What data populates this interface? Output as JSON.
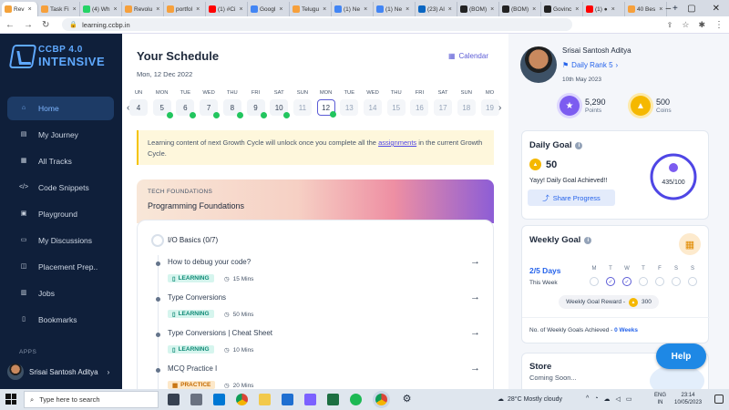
{
  "browser": {
    "tabs": [
      {
        "label": "Rev",
        "color": "#f4a23a",
        "active": true
      },
      {
        "label": "Task Fi",
        "color": "#f6a03c"
      },
      {
        "label": "(4) Wh",
        "color": "#25d366"
      },
      {
        "label": "Revolu",
        "color": "#f6a03c"
      },
      {
        "label": "portfol",
        "color": "#f6a03c"
      },
      {
        "label": "(1) #Ci",
        "color": "#ff0000"
      },
      {
        "label": "Googl",
        "color": "#4285f4"
      },
      {
        "label": "Telugu",
        "color": "#f6a03c"
      },
      {
        "label": "(1) Ne",
        "color": "#4285f4"
      },
      {
        "label": "(1) Ne",
        "color": "#4285f4"
      },
      {
        "label": "(23) Al",
        "color": "#0a66c2"
      },
      {
        "label": "(BOM)",
        "color": "#222222"
      },
      {
        "label": "(BOM)",
        "color": "#222222"
      },
      {
        "label": "Govinc",
        "color": "#222222"
      },
      {
        "label": "(1) ●",
        "color": "#ff0000"
      },
      {
        "label": "40 Bes",
        "color": "#f6a03c"
      }
    ],
    "url": "learning.ccbp.in"
  },
  "sidebar": {
    "logo_line1": "CCBP 4.0",
    "logo_line2": "INTENSIVE",
    "items": [
      {
        "label": "Home",
        "icon": "home-icon",
        "active": true
      },
      {
        "label": "My Journey",
        "icon": "journey-icon"
      },
      {
        "label": "All Tracks",
        "icon": "tracks-icon"
      },
      {
        "label": "Code Snippets",
        "icon": "code-icon"
      },
      {
        "label": "Playground",
        "icon": "terminal-icon"
      },
      {
        "label": "My Discussions",
        "icon": "chat-icon"
      },
      {
        "label": "Placement Prep..",
        "icon": "briefcase-icon"
      },
      {
        "label": "Jobs",
        "icon": "jobs-icon"
      },
      {
        "label": "Bookmarks",
        "icon": "bookmark-icon"
      }
    ],
    "apps_label": "APPS",
    "user_name": "Srisai Santosh Aditya"
  },
  "schedule": {
    "title": "Your Schedule",
    "date": "Mon, 12 Dec 2022",
    "calendar_label": "Calendar",
    "days": [
      {
        "name": "UN",
        "num": "4",
        "done": false
      },
      {
        "name": "MON",
        "num": "5",
        "done": true
      },
      {
        "name": "TUE",
        "num": "6",
        "done": true
      },
      {
        "name": "WED",
        "num": "7",
        "done": true
      },
      {
        "name": "THU",
        "num": "8",
        "done": true
      },
      {
        "name": "FRI",
        "num": "9",
        "done": true
      },
      {
        "name": "SAT",
        "num": "10",
        "done": true
      },
      {
        "name": "SUN",
        "num": "11",
        "done": false
      },
      {
        "name": "MON",
        "num": "12",
        "done": true,
        "selected": true
      },
      {
        "name": "TUE",
        "num": "13",
        "done": false
      },
      {
        "name": "WED",
        "num": "14",
        "done": false
      },
      {
        "name": "THU",
        "num": "15",
        "done": false
      },
      {
        "name": "FRI",
        "num": "16",
        "done": false
      },
      {
        "name": "SAT",
        "num": "17",
        "done": false
      },
      {
        "name": "SUN",
        "num": "18",
        "done": false
      },
      {
        "name": "MO",
        "num": "19",
        "done": false
      }
    ],
    "notice_text": "Learning content of next Growth Cycle will unlock once you complete all the",
    "notice_link": "assignments",
    "notice_tail": "in the current Growth Cycle."
  },
  "course": {
    "category": "TECH FOUNDATIONS",
    "name": "Programming Foundations",
    "topic": "I/O Basics (0/7)",
    "lessons": [
      {
        "title": "How to debug your code?",
        "tag": "LEARNING",
        "time": "15 Mins"
      },
      {
        "title": "Type Conversions",
        "tag": "LEARNING",
        "time": "50 Mins"
      },
      {
        "title": "Type Conversions | Cheat Sheet",
        "tag": "LEARNING",
        "time": "10 Mins"
      },
      {
        "title": "MCQ Practice I",
        "tag": "PRACTICE",
        "time": "20 Mins"
      }
    ]
  },
  "profile": {
    "name": "Srisai Santosh Aditya",
    "rank": "Daily Rank 5",
    "joined": "10th May 2023",
    "points_value": "5,290",
    "points_label": "Points",
    "coins_value": "500",
    "coins_label": "Coins"
  },
  "daily_goal": {
    "title": "Daily Goal",
    "coins": "50",
    "message": "Yayy! Daily Goal Achieved!!",
    "share_label": "Share Progress",
    "progress_text": "435/100"
  },
  "weekly_goal": {
    "title": "Weekly Goal",
    "days_done": "2/5 Days",
    "this_week": "This Week",
    "weekdays": [
      "M",
      "T",
      "W",
      "T",
      "F",
      "S",
      "S"
    ],
    "completed_days": [
      false,
      true,
      true,
      false,
      false,
      false,
      false
    ],
    "reward_label": "Weekly Goal Reward -",
    "reward_value": "300",
    "achieved_label": "No. of Weekly Goals Achieved -",
    "achieved_value": "0 Weeks"
  },
  "store": {
    "title": "Store",
    "subtitle": "Coming Soon..."
  },
  "help_label": "Help",
  "taskbar": {
    "search_placeholder": "Type here to search",
    "weather": "28°C  Mostly cloudy",
    "lang1": "ENG",
    "lang2": "IN",
    "time": "23:14",
    "date": "10/05/2023"
  }
}
